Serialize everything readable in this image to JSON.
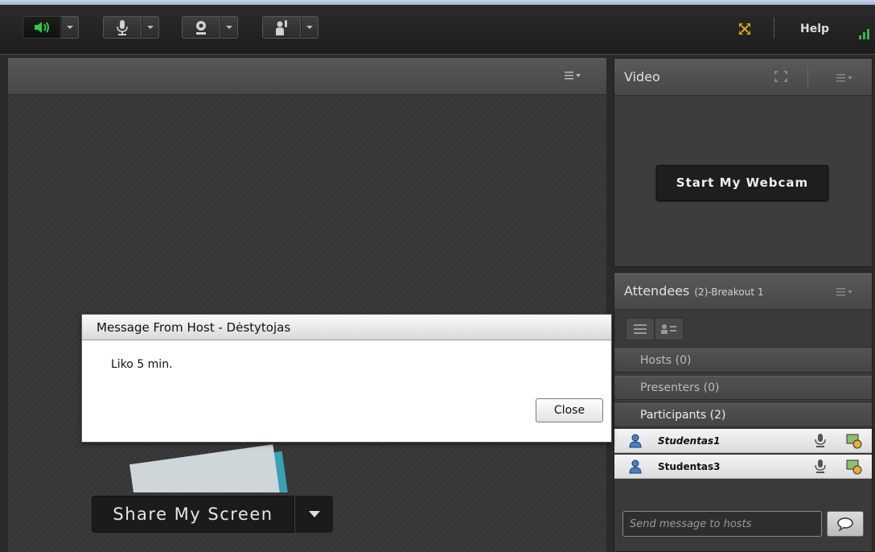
{
  "toolbar": {
    "help_label": "Help",
    "buttons": [
      {
        "icon": "speaker-icon",
        "active": true
      },
      {
        "icon": "microphone-icon",
        "active": false
      },
      {
        "icon": "webcam-icon",
        "active": false
      },
      {
        "icon": "raise-hand-icon",
        "active": false
      }
    ]
  },
  "share_pod": {
    "share_button_label": "Share My Screen"
  },
  "video_pod": {
    "title": "Video",
    "start_webcam_label": "Start My Webcam"
  },
  "attendees_pod": {
    "title": "Attendees",
    "count": "(2)-Breakout 1",
    "sections": {
      "hosts": "Hosts (0)",
      "presenters": "Presenters (0)",
      "participants": "Participants (2)"
    },
    "participants": [
      {
        "name": "Studentas1",
        "italic": true
      },
      {
        "name": "Studentas3",
        "italic": false
      }
    ],
    "chat_placeholder": "Send message to hosts"
  },
  "dialog": {
    "title": "Message From Host - Dėstytojas",
    "message": "Liko 5 min.",
    "close_label": "Close"
  },
  "colors": {
    "speaker_active": "#2ecc40",
    "fullscreen_icon": "#d9a520",
    "signal": "#3cb043"
  }
}
